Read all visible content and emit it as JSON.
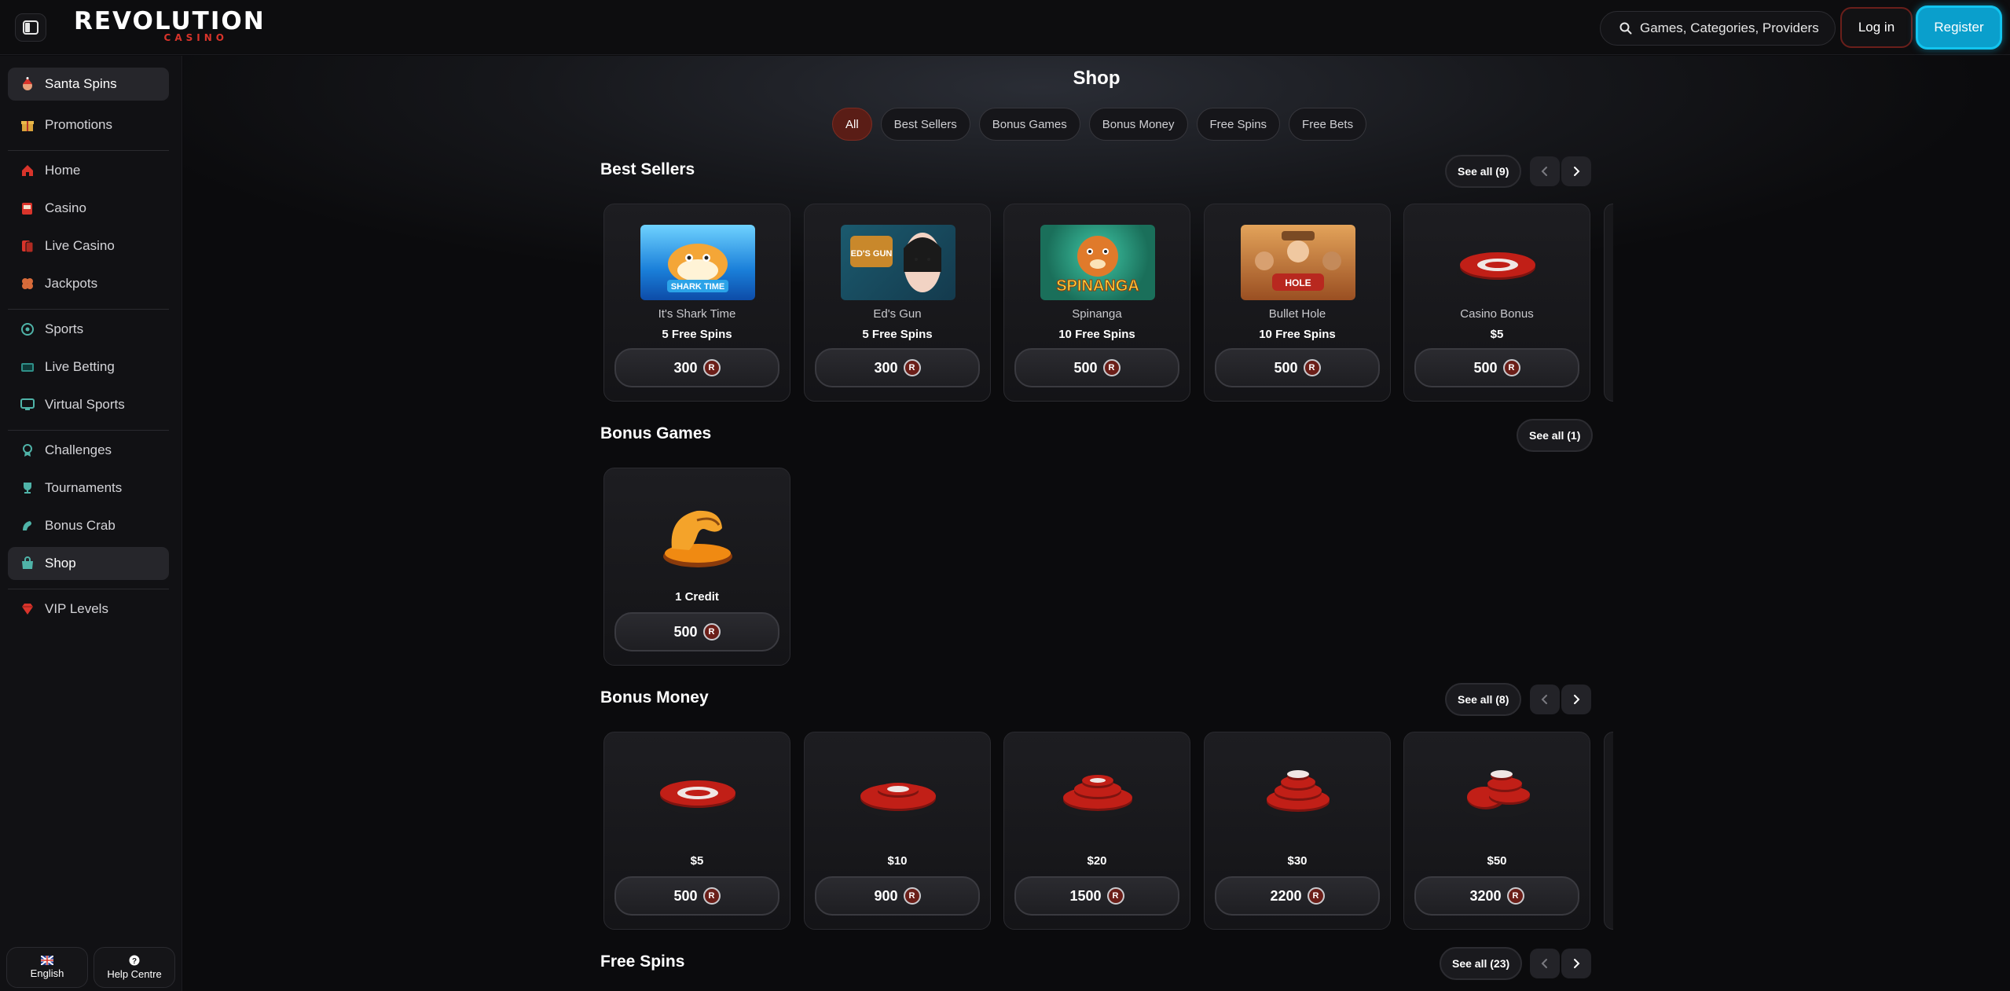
{
  "header": {
    "logo_main": "REVOLUTION",
    "logo_sub": "CASINO",
    "search_placeholder": "Games, Categories, Providers",
    "login_label": "Log in",
    "register_label": "Register",
    "accent_color": "#0a9fcc"
  },
  "sidebar": {
    "items": [
      {
        "label": "Santa Spins",
        "icon": "santa-icon"
      },
      {
        "label": "Promotions",
        "icon": "gift-icon"
      },
      {
        "label": "Home",
        "icon": "home-icon"
      },
      {
        "label": "Casino",
        "icon": "slot-machine-icon"
      },
      {
        "label": "Live Casino",
        "icon": "cards-icon"
      },
      {
        "label": "Jackpots",
        "icon": "clover-icon"
      },
      {
        "label": "Sports",
        "icon": "soccer-ball-icon"
      },
      {
        "label": "Live Betting",
        "icon": "live-tv-icon"
      },
      {
        "label": "Virtual Sports",
        "icon": "monitor-icon"
      },
      {
        "label": "Challenges",
        "icon": "medal-icon"
      },
      {
        "label": "Tournaments",
        "icon": "trophy-icon"
      },
      {
        "label": "Bonus Crab",
        "icon": "claw-icon"
      },
      {
        "label": "Shop",
        "icon": "shop-icon"
      },
      {
        "label": "VIP Levels",
        "icon": "diamond-icon"
      }
    ],
    "language_label": "English",
    "help_label": "Help Centre"
  },
  "shop": {
    "title": "Shop",
    "filters": [
      "All",
      "Best Sellers",
      "Bonus Games",
      "Bonus Money",
      "Free Spins",
      "Free Bets"
    ],
    "active_filter": "All",
    "best_sellers": {
      "title": "Best Sellers",
      "see_all": "See all (9)",
      "items": [
        {
          "name": "It's Shark Time",
          "reward": "5 Free Spins",
          "price": "300"
        },
        {
          "name": "Ed's Gun",
          "reward": "5 Free Spins",
          "price": "300"
        },
        {
          "name": "Spinanga",
          "reward": "10 Free Spins",
          "price": "500"
        },
        {
          "name": "Bullet Hole",
          "reward": "10 Free Spins",
          "price": "500"
        },
        {
          "name": "Casino Bonus",
          "reward": "$5",
          "price": "500"
        }
      ]
    },
    "bonus_games": {
      "title": "Bonus Games",
      "see_all": "See all (1)",
      "items": [
        {
          "name": "1 Credit",
          "price": "500"
        }
      ]
    },
    "bonus_money": {
      "title": "Bonus Money",
      "see_all": "See all (8)",
      "items": [
        {
          "name": "$5",
          "price": "500"
        },
        {
          "name": "$10",
          "price": "900"
        },
        {
          "name": "$20",
          "price": "1500"
        },
        {
          "name": "$30",
          "price": "2200"
        },
        {
          "name": "$50",
          "price": "3200"
        }
      ]
    },
    "free_spins": {
      "title": "Free Spins",
      "see_all": "See all (23)"
    },
    "coin_symbol": "R"
  },
  "thumb_text": {
    "shark": "SHARK TIME",
    "edsgun": "ED'S GUN",
    "spinanga": "SPINANGA",
    "bullet": "HOLE"
  }
}
